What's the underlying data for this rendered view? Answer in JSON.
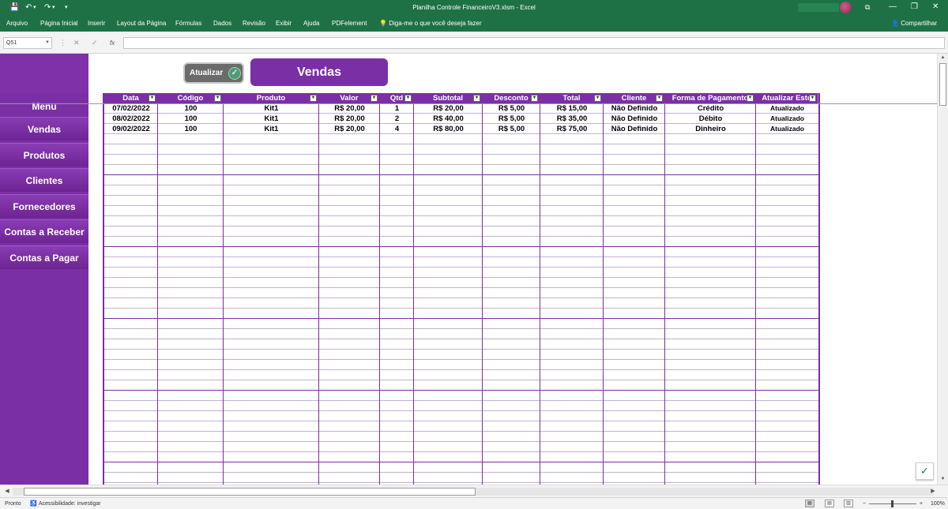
{
  "window": {
    "title": "Planilha Controle FinanceiroV3.xlsm  -  Excel",
    "quick_access": [
      "💾",
      "↶",
      "▾",
      "↷",
      "▾",
      "▾"
    ],
    "window_buttons": [
      "⧉",
      "—",
      "❐",
      "✕"
    ]
  },
  "ribbon": {
    "tabs": [
      "Arquivo",
      "Página Inicial",
      "Inserir",
      "Layout da Página",
      "Fórmulas",
      "Dados",
      "Revisão",
      "Exibir",
      "Ajuda",
      "PDFelement"
    ],
    "tell_me": "Diga-me o que você deseja fazer",
    "share": "Compartilhar"
  },
  "formula_bar": {
    "name_box": "Q51",
    "cancel_icon": "✕",
    "enter_icon": "✓",
    "fx_label": "fx",
    "formula": ""
  },
  "sidebar": {
    "menu_title": "Menu",
    "items": [
      "Vendas",
      "Produtos",
      "Clientes",
      "Fornecedores",
      "Contas a Receber",
      "Contas a Pagar"
    ]
  },
  "buttons": {
    "atualizar": "Atualizar"
  },
  "banner": "Vendas",
  "table": {
    "headers": [
      "Data",
      "Código",
      "Produto",
      "Valor",
      "Qtd",
      "Subtotal",
      "Desconto",
      "Total",
      "Cliente",
      "Forma de Pagamento",
      "Atualizar Esto"
    ],
    "rows": [
      [
        "07/02/2022",
        "100",
        "Kit1",
        "R$ 20,00",
        "1",
        "R$ 20,00",
        "R$ 5,00",
        "R$ 15,00",
        "Não Definido",
        "Crédito",
        "Atualizado"
      ],
      [
        "08/02/2022",
        "100",
        "Kit1",
        "R$ 20,00",
        "2",
        "R$ 40,00",
        "R$ 5,00",
        "R$ 35,00",
        "Não Definido",
        "Débito",
        "Atualizado"
      ],
      [
        "09/02/2022",
        "100",
        "Kit1",
        "R$ 20,00",
        "4",
        "R$ 80,00",
        "R$ 5,00",
        "R$ 75,00",
        "Não Definido",
        "Dinheiro",
        "Atualizado"
      ]
    ]
  },
  "status_bar": {
    "ready": "Pronto",
    "accessibility": "Acessibilidade: investigar",
    "zoom": "100%"
  },
  "colors": {
    "excel_green": "#1e7145",
    "purple": "#7b2fa5"
  }
}
